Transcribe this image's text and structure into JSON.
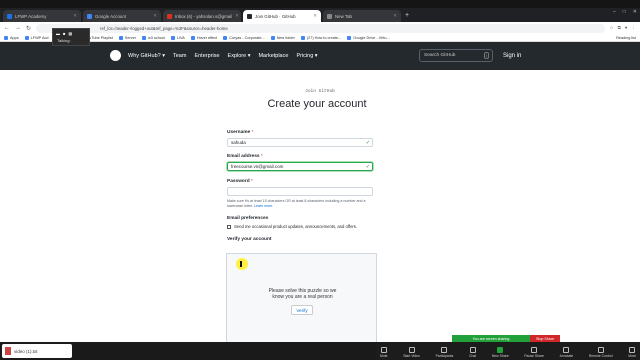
{
  "browser": {
    "tabs": [
      {
        "label": "LFWP Academy",
        "active": false,
        "color": "#1a73e8"
      },
      {
        "label": "Google Account",
        "active": false,
        "color": "#4285f4"
      },
      {
        "label": "Inbox (6) - yahsolan.s@gmail",
        "active": false,
        "color": "#d93025"
      },
      {
        "label": "Join GitHub · GitHub",
        "active": true,
        "color": "#24292e"
      },
      {
        "label": "New Tab",
        "active": false,
        "color": "#888888"
      }
    ],
    "new_tab": "+",
    "url": "ref_loc=header+logged+out&ref_page=%2F&source=header-home",
    "bookmarks": [
      "Apps",
      "LFWP Acd",
      "Google",
      "YouTube Playlist",
      "Server",
      "w3 school",
      "LIVA",
      "Hover effect",
      "Coryas - Corporate...",
      "New folder",
      "(27) How to create...",
      "Google Drive - Virtu..."
    ],
    "reading_list": "Reading list"
  },
  "zoom_overlay": {
    "talking": "Talking:"
  },
  "github": {
    "nav": [
      "Why GitHub? ▾",
      "Team",
      "Enterprise",
      "Explore ▾",
      "Marketplace",
      "Pricing ▾"
    ],
    "search_placeholder": "Search GitHub",
    "search_key": "/",
    "sign_in": "Sign in"
  },
  "signup": {
    "subtitle": "Join GitHub",
    "title": "Create your account",
    "username_label": "Username",
    "username_value": "sahuda",
    "email_label": "Email address",
    "email_value": "freecourse.vn@gmail.com",
    "password_label": "Password",
    "password_hint": "Make sure it's at least 15 characters OR at least 8 characters including a number and a lowercase letter.",
    "learn_more": "Learn more.",
    "prefs_label": "Email preferences",
    "prefs_checkbox": "Send me occasional product updates, announcements, and offers.",
    "verify_label": "Verify your account",
    "puzzle_line1": "Please solve this puzzle so we",
    "puzzle_line2": "know you are a real person",
    "verify_button": "Verify",
    "required_mark": "*",
    "check_mark": "✓"
  },
  "zoom": {
    "sharing_banner": "You are screen sharing",
    "stop_share": "Stop Share",
    "toolbar": [
      {
        "label": "Mute",
        "color": ""
      },
      {
        "label": "Start Video",
        "color": ""
      },
      {
        "label": "Participants",
        "color": ""
      },
      {
        "label": "Chat",
        "color": ""
      },
      {
        "label": "New Share",
        "color": "#22a13a"
      },
      {
        "label": "Pause Share",
        "color": ""
      },
      {
        "label": "Annotate",
        "color": ""
      },
      {
        "label": "Remote Control",
        "color": ""
      },
      {
        "label": "More",
        "color": ""
      }
    ]
  },
  "downloads": {
    "file": "video (1).txt",
    "show_all": "Show all"
  }
}
